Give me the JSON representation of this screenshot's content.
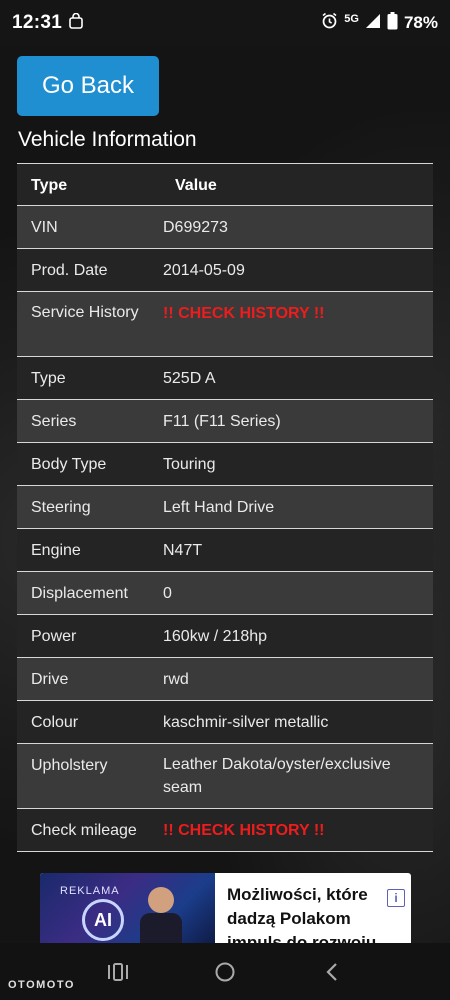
{
  "status_bar": {
    "time": "12:31",
    "network": "5G",
    "battery": "78%"
  },
  "page": {
    "go_back_label": "Go Back",
    "title": "Vehicle Information"
  },
  "table": {
    "headers": [
      "Type",
      "Value"
    ],
    "rows": [
      {
        "key": "VIN",
        "value": "D699273"
      },
      {
        "key": "Prod. Date",
        "value": "2014-05-09"
      },
      {
        "key": "Service History",
        "value": "!! CHECK HISTORY !!"
      },
      {
        "key": "Type",
        "value": "525D A"
      },
      {
        "key": "Series",
        "value": "F11 (F11 Series)"
      },
      {
        "key": "Body Type",
        "value": "Touring"
      },
      {
        "key": "Steering",
        "value": "Left Hand Drive"
      },
      {
        "key": "Engine",
        "value": "N47T"
      },
      {
        "key": "Displacement",
        "value": "0"
      },
      {
        "key": "Power",
        "value": "160kw / 218hp"
      },
      {
        "key": "Drive",
        "value": "rwd"
      },
      {
        "key": "Colour",
        "value": "kaschmir-silver metallic"
      },
      {
        "key": "Upholstery",
        "value": "Leather Dakota/oyster/exclusive seam"
      },
      {
        "key": "Check mileage",
        "value": "!! CHECK HISTORY !!"
      }
    ]
  },
  "ad": {
    "label": "REKLAMA",
    "logo_text": "AI",
    "headline": "Możliwości, które dadzą Polakom impuls do rozwoju"
  },
  "nav": {
    "brand": "OTOMOTO",
    "icons": [
      "recent-apps-icon",
      "home-icon",
      "back-icon"
    ]
  },
  "colors": {
    "accent": "#1f8fd2",
    "alert": "#ee1c1c"
  }
}
